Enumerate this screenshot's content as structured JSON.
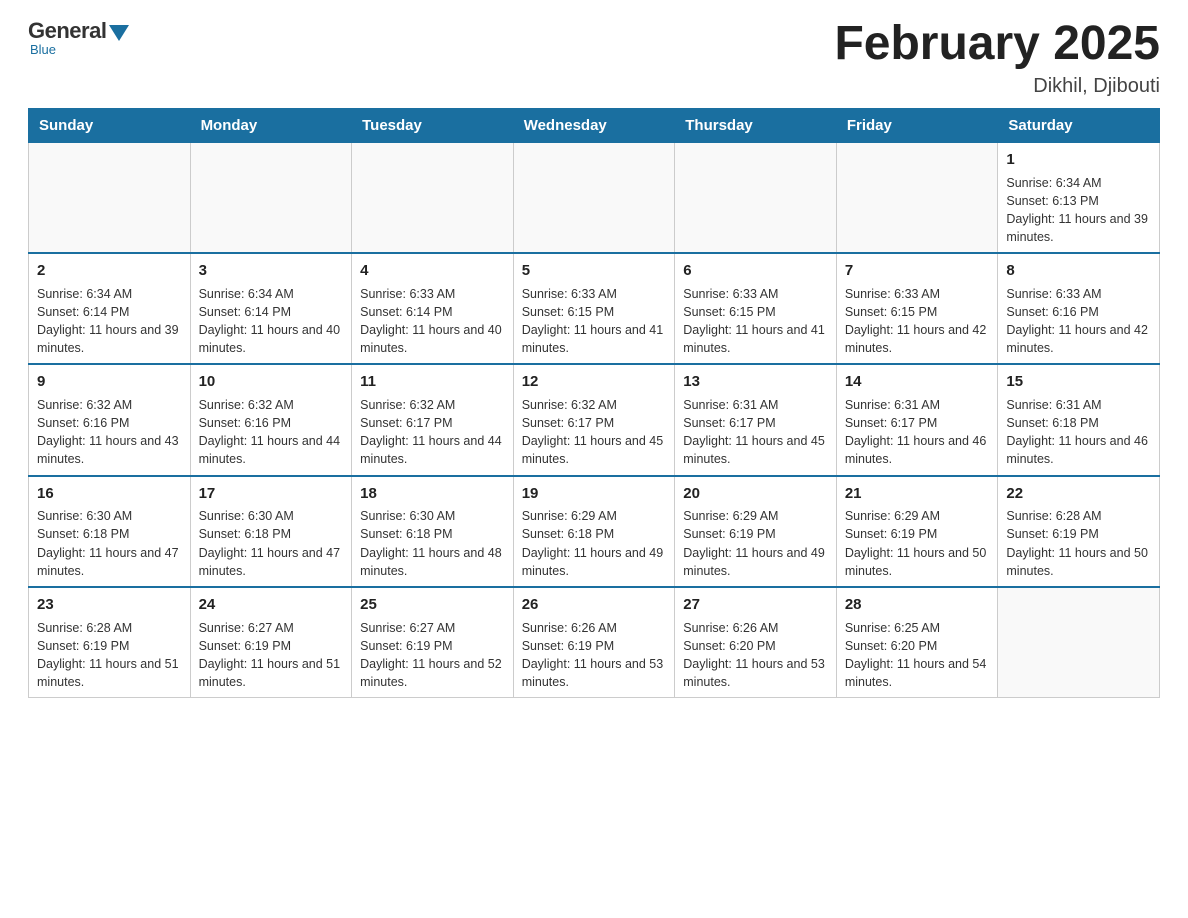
{
  "header": {
    "logo_general": "General",
    "logo_blue": "Blue",
    "month_title": "February 2025",
    "location": "Dikhil, Djibouti"
  },
  "days_of_week": [
    "Sunday",
    "Monday",
    "Tuesday",
    "Wednesday",
    "Thursday",
    "Friday",
    "Saturday"
  ],
  "weeks": [
    [
      {
        "day": "",
        "info": ""
      },
      {
        "day": "",
        "info": ""
      },
      {
        "day": "",
        "info": ""
      },
      {
        "day": "",
        "info": ""
      },
      {
        "day": "",
        "info": ""
      },
      {
        "day": "",
        "info": ""
      },
      {
        "day": "1",
        "info": "Sunrise: 6:34 AM\nSunset: 6:13 PM\nDaylight: 11 hours and 39 minutes."
      }
    ],
    [
      {
        "day": "2",
        "info": "Sunrise: 6:34 AM\nSunset: 6:14 PM\nDaylight: 11 hours and 39 minutes."
      },
      {
        "day": "3",
        "info": "Sunrise: 6:34 AM\nSunset: 6:14 PM\nDaylight: 11 hours and 40 minutes."
      },
      {
        "day": "4",
        "info": "Sunrise: 6:33 AM\nSunset: 6:14 PM\nDaylight: 11 hours and 40 minutes."
      },
      {
        "day": "5",
        "info": "Sunrise: 6:33 AM\nSunset: 6:15 PM\nDaylight: 11 hours and 41 minutes."
      },
      {
        "day": "6",
        "info": "Sunrise: 6:33 AM\nSunset: 6:15 PM\nDaylight: 11 hours and 41 minutes."
      },
      {
        "day": "7",
        "info": "Sunrise: 6:33 AM\nSunset: 6:15 PM\nDaylight: 11 hours and 42 minutes."
      },
      {
        "day": "8",
        "info": "Sunrise: 6:33 AM\nSunset: 6:16 PM\nDaylight: 11 hours and 42 minutes."
      }
    ],
    [
      {
        "day": "9",
        "info": "Sunrise: 6:32 AM\nSunset: 6:16 PM\nDaylight: 11 hours and 43 minutes."
      },
      {
        "day": "10",
        "info": "Sunrise: 6:32 AM\nSunset: 6:16 PM\nDaylight: 11 hours and 44 minutes."
      },
      {
        "day": "11",
        "info": "Sunrise: 6:32 AM\nSunset: 6:17 PM\nDaylight: 11 hours and 44 minutes."
      },
      {
        "day": "12",
        "info": "Sunrise: 6:32 AM\nSunset: 6:17 PM\nDaylight: 11 hours and 45 minutes."
      },
      {
        "day": "13",
        "info": "Sunrise: 6:31 AM\nSunset: 6:17 PM\nDaylight: 11 hours and 45 minutes."
      },
      {
        "day": "14",
        "info": "Sunrise: 6:31 AM\nSunset: 6:17 PM\nDaylight: 11 hours and 46 minutes."
      },
      {
        "day": "15",
        "info": "Sunrise: 6:31 AM\nSunset: 6:18 PM\nDaylight: 11 hours and 46 minutes."
      }
    ],
    [
      {
        "day": "16",
        "info": "Sunrise: 6:30 AM\nSunset: 6:18 PM\nDaylight: 11 hours and 47 minutes."
      },
      {
        "day": "17",
        "info": "Sunrise: 6:30 AM\nSunset: 6:18 PM\nDaylight: 11 hours and 47 minutes."
      },
      {
        "day": "18",
        "info": "Sunrise: 6:30 AM\nSunset: 6:18 PM\nDaylight: 11 hours and 48 minutes."
      },
      {
        "day": "19",
        "info": "Sunrise: 6:29 AM\nSunset: 6:18 PM\nDaylight: 11 hours and 49 minutes."
      },
      {
        "day": "20",
        "info": "Sunrise: 6:29 AM\nSunset: 6:19 PM\nDaylight: 11 hours and 49 minutes."
      },
      {
        "day": "21",
        "info": "Sunrise: 6:29 AM\nSunset: 6:19 PM\nDaylight: 11 hours and 50 minutes."
      },
      {
        "day": "22",
        "info": "Sunrise: 6:28 AM\nSunset: 6:19 PM\nDaylight: 11 hours and 50 minutes."
      }
    ],
    [
      {
        "day": "23",
        "info": "Sunrise: 6:28 AM\nSunset: 6:19 PM\nDaylight: 11 hours and 51 minutes."
      },
      {
        "day": "24",
        "info": "Sunrise: 6:27 AM\nSunset: 6:19 PM\nDaylight: 11 hours and 51 minutes."
      },
      {
        "day": "25",
        "info": "Sunrise: 6:27 AM\nSunset: 6:19 PM\nDaylight: 11 hours and 52 minutes."
      },
      {
        "day": "26",
        "info": "Sunrise: 6:26 AM\nSunset: 6:19 PM\nDaylight: 11 hours and 53 minutes."
      },
      {
        "day": "27",
        "info": "Sunrise: 6:26 AM\nSunset: 6:20 PM\nDaylight: 11 hours and 53 minutes."
      },
      {
        "day": "28",
        "info": "Sunrise: 6:25 AM\nSunset: 6:20 PM\nDaylight: 11 hours and 54 minutes."
      },
      {
        "day": "",
        "info": ""
      }
    ]
  ]
}
